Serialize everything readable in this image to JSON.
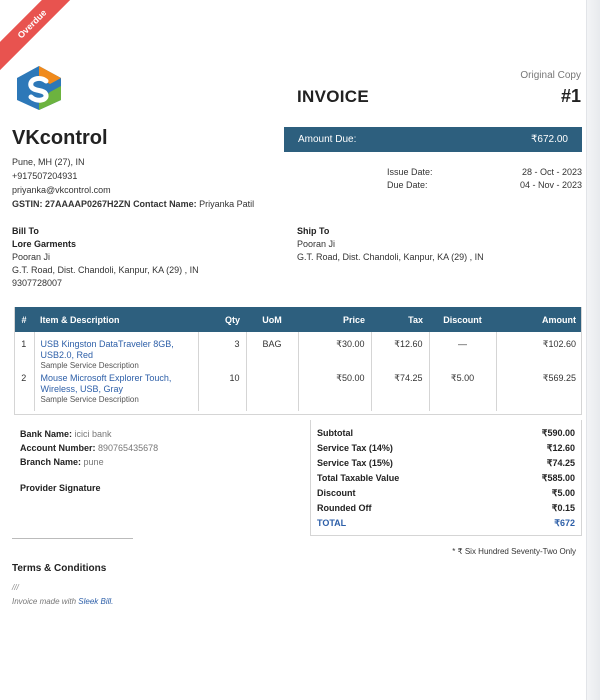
{
  "badge": {
    "status": "Overdue"
  },
  "header": {
    "copy_label": "Original Copy",
    "title": "INVOICE",
    "number": "#1"
  },
  "company": {
    "name": "VKcontrol",
    "address": "Pune, MH (27), IN",
    "phone": "+917507204931",
    "email": "priyanka@vkcontrol.com",
    "gstin_label": "GSTIN: ",
    "gstin": "27AAAAP0267H2ZN",
    "contact_label": "Contact Name: ",
    "contact": "Priyanka Patil"
  },
  "amount_due": {
    "label": "Amount Due:",
    "value": "₹672.00"
  },
  "dates": {
    "issue_label": "Issue Date:",
    "issue": "28 - Oct - 2023",
    "due_label": "Due Date:",
    "due": "04 - Nov - 2023"
  },
  "bill_to": {
    "heading": "Bill To",
    "company": "Lore Garments",
    "name": "Pooran Ji",
    "address": "G.T. Road, Dist. Chandoli, Kanpur, KA (29) , IN",
    "phone": "9307728007"
  },
  "ship_to": {
    "heading": "Ship To",
    "name": "Pooran Ji",
    "address": "G.T. Road, Dist. Chandoli, Kanpur, KA (29) , IN"
  },
  "items_table": {
    "headers": [
      "#",
      "Item & Description",
      "Qty",
      "UoM",
      "Price",
      "Tax",
      "Discount",
      "Amount"
    ],
    "rows": [
      {
        "n": "1",
        "name": "USB Kingston DataTraveler 8GB, USB2.0, Red",
        "desc": "Sample Service Description",
        "qty": "3",
        "uom": "BAG",
        "price": "₹30.00",
        "tax": "₹12.60",
        "discount": "—",
        "amount": "₹102.60"
      },
      {
        "n": "2",
        "name": "Mouse Microsoft Explorer Touch, Wireless, USB, Gray",
        "desc": "Sample Service Description",
        "qty": "10",
        "uom": "",
        "price": "₹50.00",
        "tax": "₹74.25",
        "discount": "₹5.00",
        "amount": "₹569.25"
      }
    ]
  },
  "bank": {
    "name_label": "Bank Name:",
    "name": "icici bank",
    "account_label": "Account Number:",
    "account": "890765435678",
    "branch_label": "Branch Name:",
    "branch": "pune",
    "signature": "Provider Signature"
  },
  "totals": {
    "subtotal_label": "Subtotal",
    "subtotal": "₹590.00",
    "tax1_label": "Service Tax (14%)",
    "tax1": "₹12.60",
    "tax2_label": "Service Tax (15%)",
    "tax2": "₹74.25",
    "taxable_label": "Total Taxable Value",
    "taxable": "₹585.00",
    "discount_label": "Discount",
    "discount": "₹5.00",
    "rounded_label": "Rounded Off",
    "rounded": "₹0.15",
    "total_label": "TOTAL",
    "total": "₹672"
  },
  "amount_words": "* ₹ Six Hundred Seventy-Two Only",
  "terms": {
    "heading": "Terms & Conditions",
    "value": "///"
  },
  "footer": {
    "made_prefix": "Invoice made with ",
    "made_link": "Sleek Bill."
  },
  "colors": {
    "accent": "#2d5f7e",
    "link": "#2d5fa8",
    "badge": "#e8534f"
  }
}
